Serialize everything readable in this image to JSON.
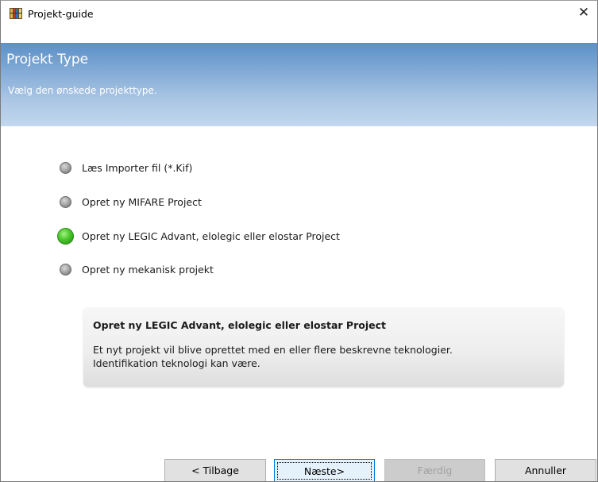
{
  "window": {
    "title": "Projekt-guide",
    "close_glyph": "✕",
    "icon": "app-icon"
  },
  "header": {
    "title": "Projekt Type",
    "subtitle": "Vælg den ønskede projekttype."
  },
  "options": [
    {
      "label": "Læs Importer fil (*.Kif)",
      "selected": false
    },
    {
      "label": "Opret ny MIFARE Project",
      "selected": false
    },
    {
      "label": "Opret ny LEGIC Advant, elolegic eller elostar Project",
      "selected": true
    },
    {
      "label": "Opret ny mekanisk projekt",
      "selected": false
    }
  ],
  "description": {
    "title": "Opret ny LEGIC Advant, elolegic eller elostar Project",
    "line1": "Et nyt projekt vil blive oprettet med en eller flere beskrevne teknologier.",
    "line2": "Identifikation teknologi kan være."
  },
  "buttons": {
    "back": "< Tilbage",
    "next": "Næste>",
    "finish": "Færdig",
    "cancel": "Annuller"
  },
  "colors": {
    "header_gradient_top": "#5c90c8",
    "header_gradient_bottom": "#c3d7ee",
    "selected_radio": "#4fcc2e",
    "unselected_radio": "#a9a9a9",
    "focus_border": "#0078d7"
  }
}
